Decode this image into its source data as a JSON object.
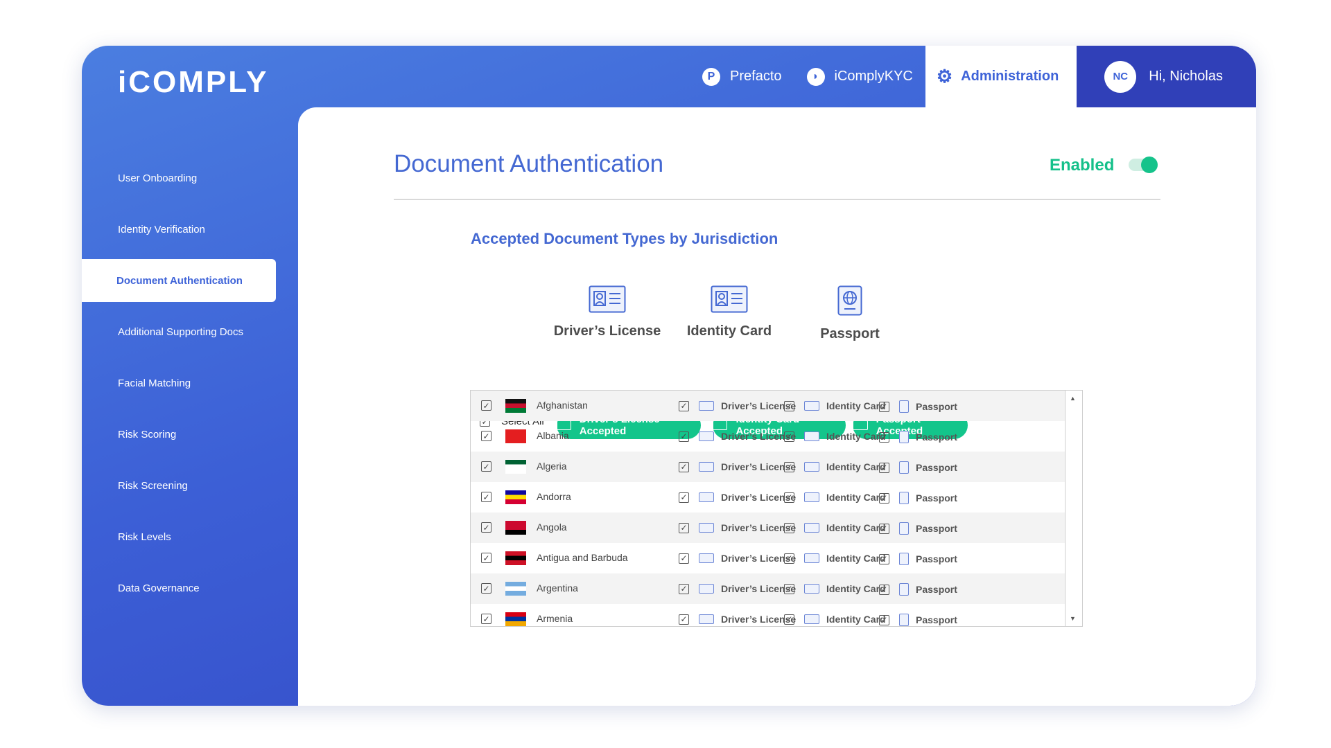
{
  "brand": {
    "logo": "iCOMPLY"
  },
  "topnav": {
    "items": [
      {
        "icon": "prefacto-icon",
        "glyph": "P",
        "label": "Prefacto"
      },
      {
        "icon": "icomply-kyc-icon",
        "glyph": "◗",
        "label": "iComplyKYC"
      }
    ],
    "active": {
      "icon": "gear-icon",
      "label": "Administration"
    },
    "user": {
      "initials": "NC",
      "greeting": "Hi, Nicholas"
    }
  },
  "sidebar": {
    "items": [
      {
        "label": "User Onboarding"
      },
      {
        "label": "Identity Verification"
      },
      {
        "label": "Document Authentication",
        "active": true
      },
      {
        "label": "Additional Supporting Docs"
      },
      {
        "label": "Facial Matching"
      },
      {
        "label": "Risk Scoring"
      },
      {
        "label": "Risk Screening"
      },
      {
        "label": "Risk Levels"
      },
      {
        "label": "Data Governance"
      }
    ]
  },
  "main": {
    "title": "Document Authentication",
    "status": "Enabled",
    "enabled": true,
    "section_title": "Accepted Document Types by Jurisdiction",
    "doc_types": [
      {
        "label": "Driver’s License",
        "icon": "drivers-license-icon"
      },
      {
        "label": "Identity Card",
        "icon": "identity-card-icon"
      },
      {
        "label": "Passport",
        "icon": "passport-icon"
      }
    ],
    "select_all": "Select All",
    "pills": [
      {
        "label": "Driver’s License Accepted"
      },
      {
        "label": "Identity Card Accepted"
      },
      {
        "label": "Passport Accepted"
      }
    ],
    "col_labels": {
      "dl": "Driver’s License",
      "id": "Identity Card",
      "pp": "Passport"
    },
    "rows": [
      {
        "country": "Afghanistan",
        "flag_colors": [
          "#111111",
          "#c8102e",
          "#007a36"
        ]
      },
      {
        "country": "Albania",
        "flag_colors": [
          "#e41e20",
          "#e41e20",
          "#e41e20"
        ]
      },
      {
        "country": "Algeria",
        "flag_colors": [
          "#006233",
          "#ffffff",
          "#ffffff"
        ]
      },
      {
        "country": "Andorra",
        "flag_colors": [
          "#10069f",
          "#fedd00",
          "#d50032"
        ]
      },
      {
        "country": "Angola",
        "flag_colors": [
          "#cc092f",
          "#cc092f",
          "#000000"
        ]
      },
      {
        "country": "Antigua and Barbuda",
        "flag_colors": [
          "#ce1126",
          "#000000",
          "#ce1126"
        ]
      },
      {
        "country": "Argentina",
        "flag_colors": [
          "#74acdf",
          "#ffffff",
          "#74acdf"
        ]
      },
      {
        "country": "Armenia",
        "flag_colors": [
          "#d90012",
          "#0033a0",
          "#f2a800"
        ]
      }
    ]
  }
}
